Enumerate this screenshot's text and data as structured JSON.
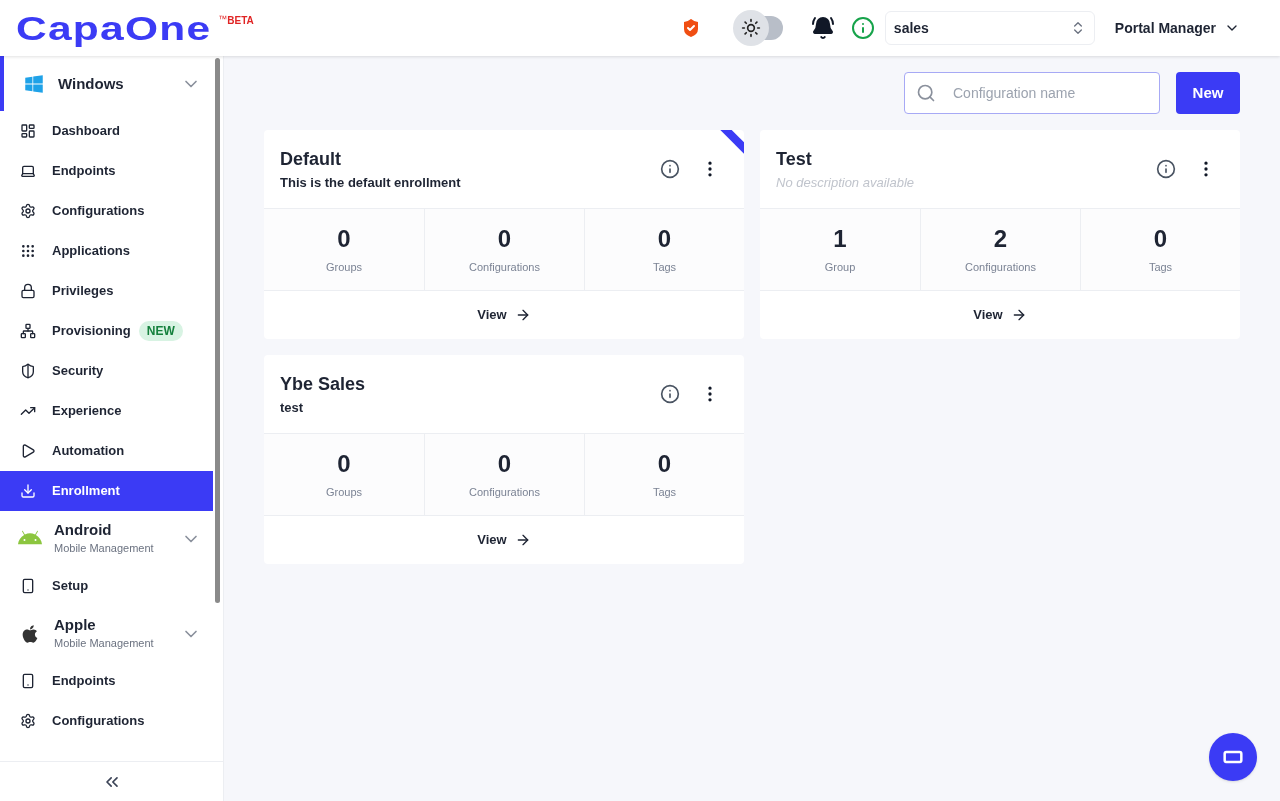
{
  "header": {
    "logo": "CapaOne",
    "logo_tm": "™",
    "logo_badge": "BETA",
    "theme_toggle": {
      "on": false
    },
    "tenant_select": {
      "value": "sales"
    },
    "user_menu": "Portal Manager"
  },
  "sidebar": {
    "sections": [
      {
        "kind": "windows",
        "name": "Windows",
        "selected": true,
        "expanded": true,
        "items": [
          {
            "label": "Dashboard",
            "selected": false
          },
          {
            "label": "Endpoints",
            "selected": false
          },
          {
            "label": "Configurations",
            "selected": false
          },
          {
            "label": "Applications",
            "selected": false
          },
          {
            "label": "Privileges",
            "selected": false
          },
          {
            "label": "Provisioning",
            "selected": false,
            "badge": "NEW"
          },
          {
            "label": "Security",
            "selected": false
          },
          {
            "label": "Experience",
            "selected": false
          },
          {
            "label": "Automation",
            "selected": false
          },
          {
            "label": "Enrollment",
            "selected": true
          }
        ]
      },
      {
        "kind": "android",
        "name": "Android",
        "subtitle": "Mobile Management",
        "selected": false,
        "expanded": true,
        "items": [
          {
            "label": "Setup",
            "selected": false
          }
        ]
      },
      {
        "kind": "apple",
        "name": "Apple",
        "subtitle": "Mobile Management",
        "selected": false,
        "expanded": true,
        "items": [
          {
            "label": "Endpoints",
            "selected": false
          },
          {
            "label": "Configurations",
            "selected": false
          }
        ]
      }
    ]
  },
  "toolbar": {
    "search": {
      "placeholder": "Configuration name"
    },
    "new_button": "New"
  },
  "cards": [
    {
      "title": "Default",
      "description": "This is the default enrollment",
      "description_missing": false,
      "default": true,
      "stats": [
        {
          "value": "0",
          "label": "Groups"
        },
        {
          "value": "0",
          "label": "Configurations"
        },
        {
          "value": "0",
          "label": "Tags"
        }
      ],
      "link": "View"
    },
    {
      "title": "Test",
      "description": "No description available",
      "description_missing": true,
      "default": false,
      "stats": [
        {
          "value": "1",
          "label": "Group"
        },
        {
          "value": "2",
          "label": "Configurations"
        },
        {
          "value": "0",
          "label": "Tags"
        }
      ],
      "link": "View"
    },
    {
      "title": "Ybe Sales",
      "description": "test",
      "description_missing": false,
      "default": false,
      "stats": [
        {
          "value": "0",
          "label": "Groups"
        },
        {
          "value": "0",
          "label": "Configurations"
        },
        {
          "value": "0",
          "label": "Tags"
        }
      ],
      "link": "View"
    }
  ]
}
